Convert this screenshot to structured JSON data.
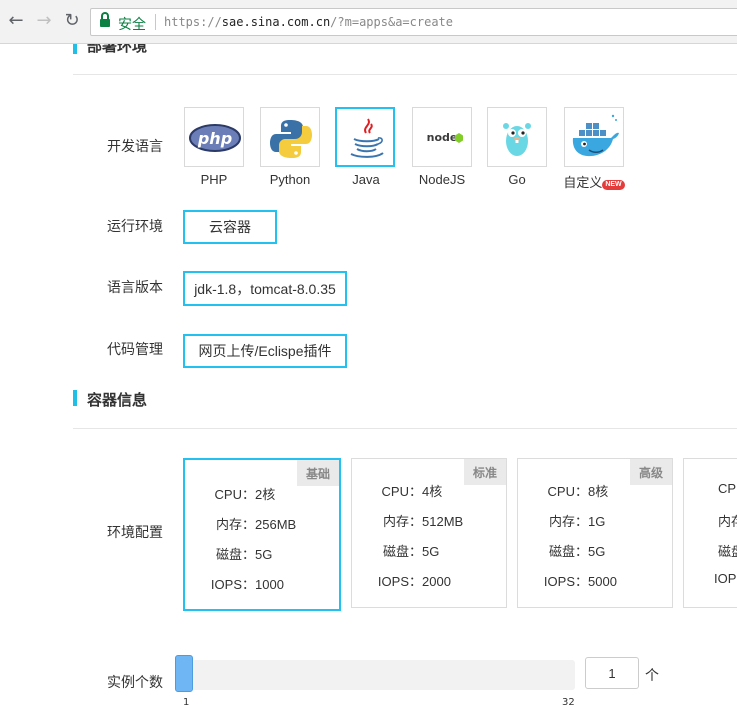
{
  "browser": {
    "security_label": "安全",
    "url_scheme": "https://",
    "url_host": "sae.sina.com.cn",
    "url_path": "/?m=apps&a=create"
  },
  "sections": {
    "deploy": {
      "title": "部署环境"
    },
    "container": {
      "title": "容器信息"
    }
  },
  "dev_language": {
    "label": "开发语言",
    "options": [
      {
        "name": "PHP",
        "icon": "php-logo-icon"
      },
      {
        "name": "Python",
        "icon": "python-logo-icon"
      },
      {
        "name": "Java",
        "icon": "java-logo-icon",
        "selected": true
      },
      {
        "name": "NodeJS",
        "icon": "nodejs-logo-icon"
      },
      {
        "name": "Go",
        "icon": "go-gopher-icon"
      },
      {
        "name": "自定义",
        "icon": "docker-whale-icon",
        "badge": "NEW"
      }
    ]
  },
  "runtime": {
    "label": "运行环境",
    "value": "云容器"
  },
  "lang_version": {
    "label": "语言版本",
    "value": "jdk-1.8，tomcat-8.0.35"
  },
  "code_mgmt": {
    "label": "代码管理",
    "value": "网页上传/Eclispe插件"
  },
  "env_config": {
    "label": "环境配置",
    "keys": {
      "cpu": "CPU：",
      "mem": "内存：",
      "disk": "磁盘：",
      "iops": "IOPS："
    },
    "cards": [
      {
        "tier": "基础",
        "cpu": "2核",
        "mem": "256MB",
        "disk": "5G",
        "iops": "1000",
        "selected": true
      },
      {
        "tier": "标准",
        "cpu": "4核",
        "mem": "512MB",
        "disk": "5G",
        "iops": "2000"
      },
      {
        "tier": "高级",
        "cpu": "8核",
        "mem": "1G",
        "disk": "5G",
        "iops": "5000"
      },
      {
        "tier": "",
        "cpu": "",
        "mem": "",
        "disk": "",
        "iops": ""
      }
    ]
  },
  "instances": {
    "label": "实例个数",
    "value": "1",
    "unit": "个",
    "min_label": "1",
    "max_label": "32",
    "min": 1,
    "max": 32
  },
  "colors": {
    "accent": "#23c1f0",
    "secure": "#0b8043",
    "slider_thumb": "#6fb6f5"
  }
}
